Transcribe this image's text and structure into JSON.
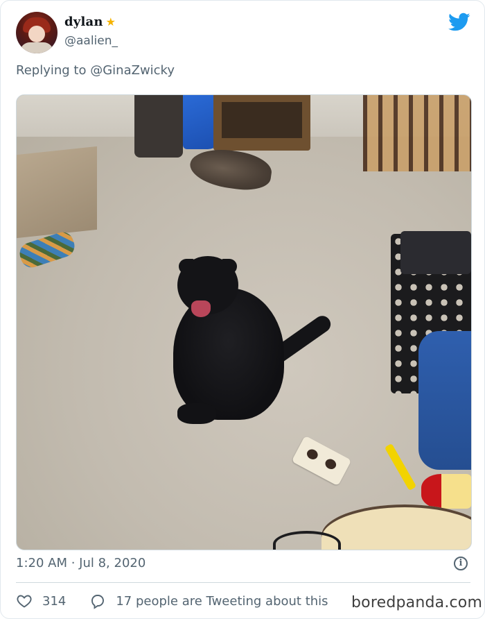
{
  "tweet": {
    "display_name": "dylan",
    "name_emoji": "★",
    "handle": "@aalien_",
    "reply_prefix": "Replying to",
    "reply_to": "@GinaZwicky",
    "timestamp": "1:20 AM · Jul 8, 2020",
    "likes": "314",
    "conversation": "17 people are Tweeting about this"
  },
  "icons": {
    "brand": "twitter-bird-icon",
    "info": "info-icon",
    "like": "heart-icon",
    "reply": "speech-bubble-icon"
  },
  "colors": {
    "twitter_blue": "#1d9bf0",
    "muted_text": "#536471",
    "border": "#cfd9de"
  },
  "watermark": "boredpanda.com"
}
